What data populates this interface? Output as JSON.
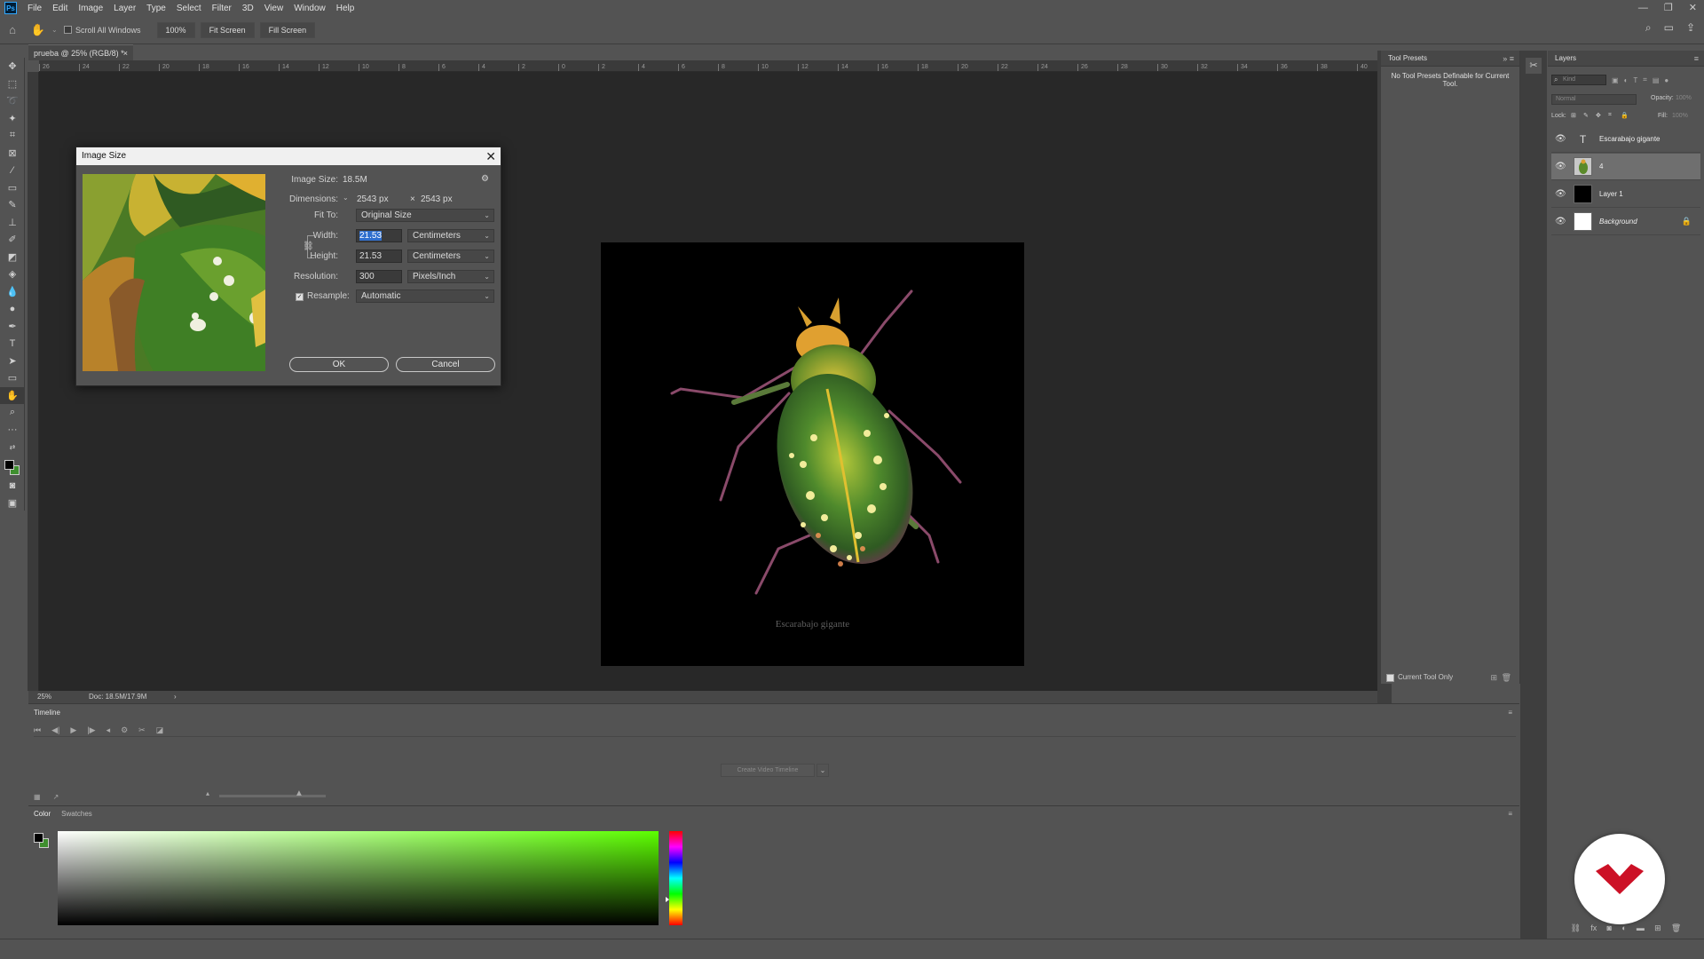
{
  "app": {
    "name": "Photoshop",
    "logo_text": "Ps"
  },
  "menu": [
    "File",
    "Edit",
    "Image",
    "Layer",
    "Type",
    "Select",
    "Filter",
    "3D",
    "View",
    "Window",
    "Help"
  ],
  "window_controls": {
    "minimize": "—",
    "restore": "❐",
    "close": "✕"
  },
  "options": {
    "scroll_all_windows": "Scroll All Windows",
    "zoom": "100%",
    "fit_screen": "Fit Screen",
    "fill_screen": "Fill Screen"
  },
  "document": {
    "tab_title": "prueba @ 25% (RGB/8) *",
    "close": "×",
    "canvas_caption": "Escarabajo gigante",
    "ruler_labels": [
      "26",
      "24",
      "22",
      "20",
      "18",
      "16",
      "14",
      "12",
      "10",
      "8",
      "6",
      "4",
      "2",
      "0",
      "2",
      "4",
      "6",
      "8",
      "10",
      "12",
      "14",
      "16",
      "18",
      "20",
      "22",
      "24",
      "26",
      "28",
      "30",
      "32",
      "34",
      "36",
      "38",
      "40"
    ]
  },
  "status": {
    "zoom": "25%",
    "doc": "Doc: 18.5M/17.9M",
    "arrow": "›"
  },
  "dialog": {
    "title": "Image Size",
    "close": "✕",
    "image_size_label": "Image Size:",
    "image_size_value": "18.5M",
    "dimensions_label": "Dimensions:",
    "dim_width": "2543 px",
    "dim_x": "×",
    "dim_height": "2543 px",
    "fit_to_label": "Fit To:",
    "fit_to_value": "Original Size",
    "width_label": "Width:",
    "width_value": "21.53",
    "width_unit": "Centimeters",
    "height_label": "Height:",
    "height_value": "21.53",
    "height_unit": "Centimeters",
    "resolution_label": "Resolution:",
    "resolution_value": "300",
    "resolution_unit": "Pixels/Inch",
    "resample_label": "Resample:",
    "resample_value": "Automatic",
    "resample_checked": true,
    "ok": "OK",
    "cancel": "Cancel"
  },
  "tool_presets": {
    "title": "Tool Presets",
    "message": "No Tool Presets Definable for Current Tool.",
    "current_tool_only": "Current Tool Only"
  },
  "layers": {
    "title": "Layers",
    "kind_placeholder": "Kind",
    "blend_mode": "Normal",
    "opacity_label": "Opacity:",
    "opacity_value": "100%",
    "lock_label": "Lock:",
    "fill_label": "Fill:",
    "fill_value": "100%",
    "items": [
      {
        "name": "Escarabajo gigante",
        "type": "text"
      },
      {
        "name": "4",
        "type": "image"
      },
      {
        "name": "Layer 1",
        "type": "fill-black"
      },
      {
        "name": "Background",
        "type": "fill-white"
      }
    ],
    "selected_index": 1
  },
  "timeline": {
    "title": "Timeline",
    "create_button": "Create Video Timeline"
  },
  "color_panel": {
    "tabs": [
      "Color",
      "Swatches"
    ],
    "active_tab": 0,
    "foreground": "#000000",
    "background": "#3f8f2f",
    "hue_color": "#5cff00"
  },
  "colors": {
    "accent_selection": "#2f6fce",
    "watermark_brand": "#cc1126"
  }
}
